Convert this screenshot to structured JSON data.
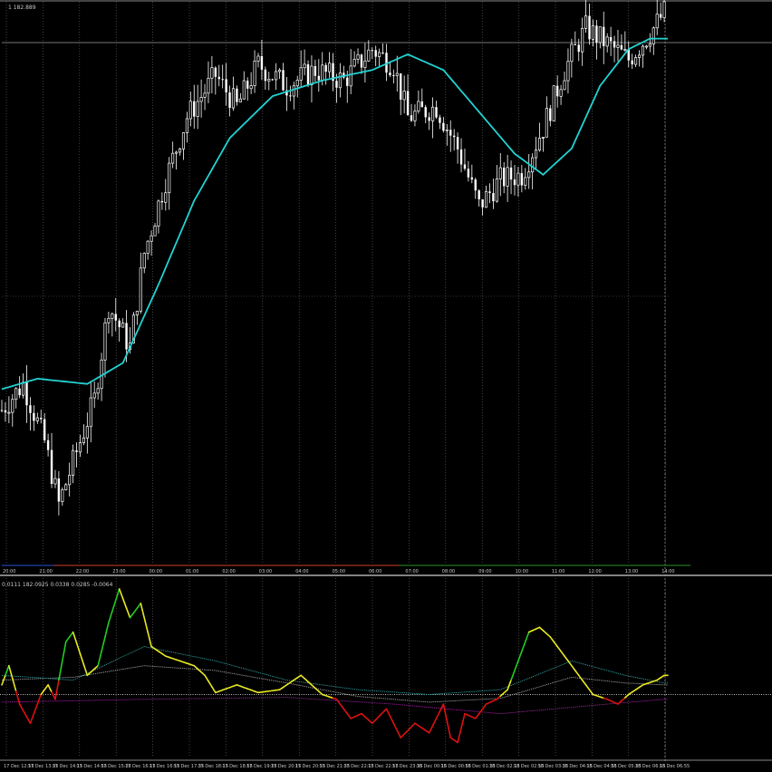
{
  "chart_data": [
    {
      "type": "candlestick",
      "panel": "main",
      "title_text": "1 182.889",
      "time_labels": [
        "20:00",
        "21:00",
        "22:00",
        "23:00",
        "00:00",
        "01:00",
        "02:00",
        "03:00",
        "04:00",
        "05:00",
        "06:00",
        "07:00",
        "08:00",
        "09:00",
        "10:00",
        "11:00",
        "12:00",
        "13:00",
        "14:00"
      ],
      "price_scale": {
        "min": 0,
        "max": 100
      },
      "ohlc_anchors": [
        {
          "bar": 0,
          "close": 28
        },
        {
          "bar": 6,
          "close": 33
        },
        {
          "bar": 12,
          "close": 22
        },
        {
          "bar": 16,
          "close": 10
        },
        {
          "bar": 20,
          "close": 18
        },
        {
          "bar": 26,
          "close": 30
        },
        {
          "bar": 30,
          "close": 48
        },
        {
          "bar": 36,
          "close": 40
        },
        {
          "bar": 40,
          "close": 58
        },
        {
          "bar": 46,
          "close": 72
        },
        {
          "bar": 52,
          "close": 84
        },
        {
          "bar": 60,
          "close": 92
        },
        {
          "bar": 66,
          "close": 86
        },
        {
          "bar": 72,
          "close": 94
        },
        {
          "bar": 80,
          "close": 90
        },
        {
          "bar": 88,
          "close": 93
        },
        {
          "bar": 96,
          "close": 91
        },
        {
          "bar": 104,
          "close": 97
        },
        {
          "bar": 110,
          "close": 94
        },
        {
          "bar": 114,
          "close": 84
        },
        {
          "bar": 122,
          "close": 86
        },
        {
          "bar": 128,
          "close": 78
        },
        {
          "bar": 134,
          "close": 67
        },
        {
          "bar": 140,
          "close": 72
        },
        {
          "bar": 146,
          "close": 73
        },
        {
          "bar": 152,
          "close": 82
        },
        {
          "bar": 158,
          "close": 93
        },
        {
          "bar": 164,
          "close": 101
        },
        {
          "bar": 170,
          "close": 98
        },
        {
          "bar": 176,
          "close": 95
        },
        {
          "bar": 182,
          "close": 100
        },
        {
          "bar": 186,
          "close": 104
        }
      ],
      "ma_anchors": [
        {
          "bar": 0,
          "value": 32
        },
        {
          "bar": 10,
          "value": 34
        },
        {
          "bar": 24,
          "value": 33
        },
        {
          "bar": 34,
          "value": 37
        },
        {
          "bar": 44,
          "value": 52
        },
        {
          "bar": 54,
          "value": 68
        },
        {
          "bar": 64,
          "value": 80
        },
        {
          "bar": 76,
          "value": 88
        },
        {
          "bar": 90,
          "value": 91
        },
        {
          "bar": 104,
          "value": 93
        },
        {
          "bar": 114,
          "value": 96
        },
        {
          "bar": 124,
          "value": 93
        },
        {
          "bar": 134,
          "value": 85
        },
        {
          "bar": 144,
          "value": 77
        },
        {
          "bar": 152,
          "value": 73
        },
        {
          "bar": 160,
          "value": 78
        },
        {
          "bar": 168,
          "value": 90
        },
        {
          "bar": 176,
          "value": 97
        },
        {
          "bar": 182,
          "value": 99
        },
        {
          "bar": 188,
          "value": 99
        }
      ],
      "colors": {
        "candle": "#ffffff",
        "ma": "#22d3d3",
        "grid": "#6a6a6a",
        "background": "#000000"
      }
    },
    {
      "type": "line",
      "panel": "indicator",
      "title_text": "0.0111 182.0925 0.0338 0.0285 -0.0064",
      "time_labels": [
        "17 Dec 12:55",
        "17 Dec 13:35",
        "17 Dec 14:15",
        "17 Dec 14:55",
        "17 Dec 15:35",
        "17 Dec 16:15",
        "17 Dec 16:55",
        "17 Dec 17:35",
        "17 Dec 18:15",
        "17 Dec 18:55",
        "17 Dec 19:35",
        "17 Dec 20:15",
        "17 Dec 20:55",
        "17 Dec 21:35",
        "17 Dec 22:15",
        "17 Dec 22:55",
        "17 Dec 23:35",
        "18 Dec 00:15",
        "18 Dec 00:55",
        "18 Dec 01:35",
        "18 Dec 02:15",
        "18 Dec 02:55",
        "18 Dec 03:35",
        "18 Dec 04:15",
        "18 Dec 04:55",
        "18 Dec 05:35",
        "18 Dec 06:15",
        "18 Dec 06:55"
      ],
      "zero_level": 0,
      "value_scale": {
        "min": -0.06,
        "max": 0.11
      },
      "main_line_anchors": [
        {
          "bar": 0,
          "value": 0.01
        },
        {
          "bar": 2,
          "value": 0.03
        },
        {
          "bar": 5,
          "value": -0.01
        },
        {
          "bar": 8,
          "value": -0.03
        },
        {
          "bar": 11,
          "value": 0.0
        },
        {
          "bar": 13,
          "value": 0.01
        },
        {
          "bar": 15,
          "value": -0.005
        },
        {
          "bar": 18,
          "value": 0.055
        },
        {
          "bar": 20,
          "value": 0.065
        },
        {
          "bar": 24,
          "value": 0.02
        },
        {
          "bar": 27,
          "value": 0.03
        },
        {
          "bar": 30,
          "value": 0.075
        },
        {
          "bar": 33,
          "value": 0.11
        },
        {
          "bar": 36,
          "value": 0.08
        },
        {
          "bar": 39,
          "value": 0.095
        },
        {
          "bar": 42,
          "value": 0.05
        },
        {
          "bar": 46,
          "value": 0.04
        },
        {
          "bar": 50,
          "value": 0.035
        },
        {
          "bar": 54,
          "value": 0.03
        },
        {
          "bar": 57,
          "value": 0.02
        },
        {
          "bar": 60,
          "value": 0.002
        },
        {
          "bar": 66,
          "value": 0.01
        },
        {
          "bar": 72,
          "value": 0.002
        },
        {
          "bar": 78,
          "value": 0.005
        },
        {
          "bar": 84,
          "value": 0.02
        },
        {
          "bar": 87,
          "value": 0.01
        },
        {
          "bar": 90,
          "value": 0.0
        },
        {
          "bar": 94,
          "value": -0.005
        },
        {
          "bar": 98,
          "value": -0.025
        },
        {
          "bar": 101,
          "value": -0.02
        },
        {
          "bar": 104,
          "value": -0.03
        },
        {
          "bar": 108,
          "value": -0.015
        },
        {
          "bar": 112,
          "value": -0.045
        },
        {
          "bar": 116,
          "value": -0.03
        },
        {
          "bar": 120,
          "value": -0.04
        },
        {
          "bar": 124,
          "value": -0.01
        },
        {
          "bar": 126,
          "value": -0.045
        },
        {
          "bar": 128,
          "value": -0.05
        },
        {
          "bar": 130,
          "value": -0.02
        },
        {
          "bar": 133,
          "value": -0.025
        },
        {
          "bar": 136,
          "value": -0.01
        },
        {
          "bar": 139,
          "value": -0.005
        },
        {
          "bar": 142,
          "value": 0.005
        },
        {
          "bar": 145,
          "value": 0.035
        },
        {
          "bar": 148,
          "value": 0.065
        },
        {
          "bar": 151,
          "value": 0.07
        },
        {
          "bar": 154,
          "value": 0.06
        },
        {
          "bar": 158,
          "value": 0.04
        },
        {
          "bar": 162,
          "value": 0.02
        },
        {
          "bar": 166,
          "value": 0.0
        },
        {
          "bar": 170,
          "value": -0.005
        },
        {
          "bar": 173,
          "value": -0.01
        },
        {
          "bar": 176,
          "value": 0.0
        },
        {
          "bar": 180,
          "value": 0.01
        },
        {
          "bar": 184,
          "value": 0.015
        },
        {
          "bar": 186,
          "value": 0.02
        }
      ],
      "signal_line_anchors": [
        {
          "bar": 0,
          "value": 0.02
        },
        {
          "bar": 20,
          "value": 0.015
        },
        {
          "bar": 40,
          "value": 0.05
        },
        {
          "bar": 60,
          "value": 0.035
        },
        {
          "bar": 80,
          "value": 0.015
        },
        {
          "bar": 100,
          "value": 0.005
        },
        {
          "bar": 120,
          "value": 0.0
        },
        {
          "bar": 140,
          "value": 0.005
        },
        {
          "bar": 160,
          "value": 0.035
        },
        {
          "bar": 175,
          "value": 0.02
        },
        {
          "bar": 186,
          "value": 0.012
        }
      ],
      "slow_line_anchors": [
        {
          "bar": 0,
          "value": 0.015
        },
        {
          "bar": 20,
          "value": 0.018
        },
        {
          "bar": 40,
          "value": 0.03
        },
        {
          "bar": 60,
          "value": 0.025
        },
        {
          "bar": 80,
          "value": 0.012
        },
        {
          "bar": 100,
          "value": -0.002
        },
        {
          "bar": 120,
          "value": -0.008
        },
        {
          "bar": 140,
          "value": -0.004
        },
        {
          "bar": 160,
          "value": 0.018
        },
        {
          "bar": 175,
          "value": 0.012
        },
        {
          "bar": 186,
          "value": 0.01
        }
      ],
      "base_line_anchors": [
        {
          "bar": 0,
          "value": -0.008
        },
        {
          "bar": 40,
          "value": -0.005
        },
        {
          "bar": 80,
          "value": -0.003
        },
        {
          "bar": 110,
          "value": -0.01
        },
        {
          "bar": 140,
          "value": -0.02
        },
        {
          "bar": 170,
          "value": -0.01
        },
        {
          "bar": 186,
          "value": -0.005
        }
      ],
      "colors": {
        "up": "#22cc22",
        "flat": "#e8e822",
        "down": "#dd1111",
        "signal": "#33aaaa",
        "slow": "#aaaaaa",
        "base": "#aa22aa",
        "zero": "#ffffff"
      }
    }
  ]
}
